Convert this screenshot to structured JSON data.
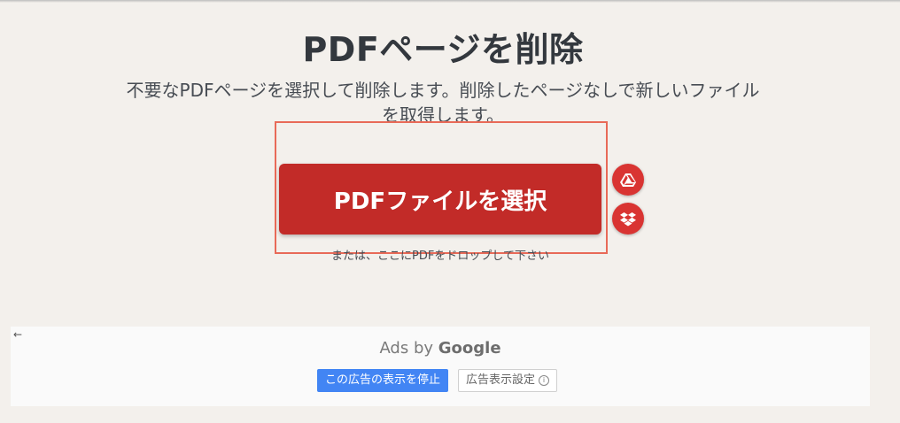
{
  "page": {
    "title": "PDFページを削除",
    "subtitle": "不要なPDFページを選択して削除します。削除したページなしで新しいファイル\nを取得します。"
  },
  "upload": {
    "select_label": "PDFファイルを選択",
    "drop_hint": "または、ここにPDFをドロップして下さい",
    "drive_icon": "google-drive-icon",
    "dropbox_icon": "dropbox-icon"
  },
  "ad": {
    "back_arrow": "←",
    "ads_by": "Ads by ",
    "google": "Google",
    "stop_label": "この広告の表示を停止",
    "settings_label": "広告表示設定",
    "info_glyph": "i"
  },
  "colors": {
    "accent": "#c22b28",
    "highlight": "#e86a58",
    "background": "#f3f0ec",
    "ad_button": "#4285f4"
  }
}
